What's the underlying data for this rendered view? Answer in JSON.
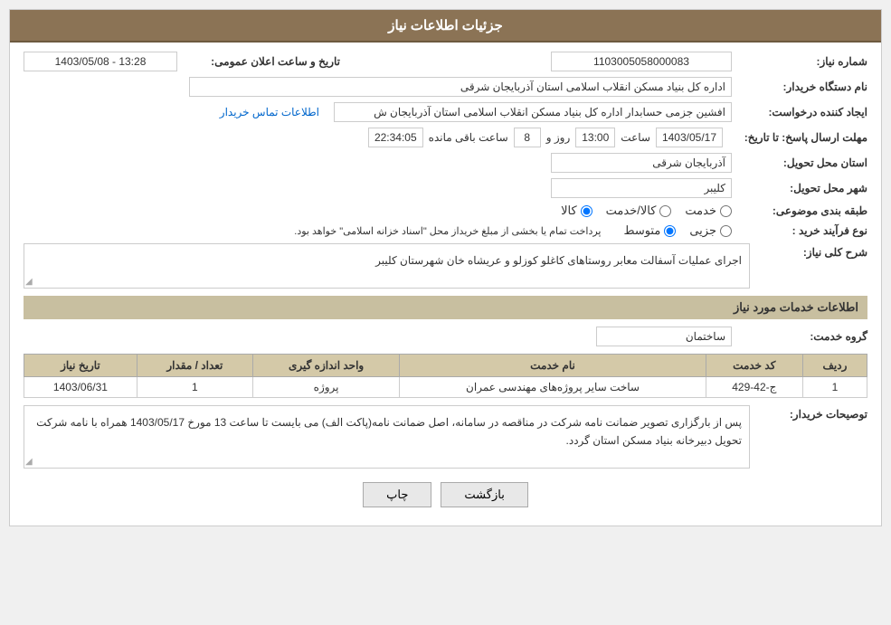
{
  "header": {
    "title": "جزئیات اطلاعات نیاز"
  },
  "fields": {
    "niaz_number_label": "شماره نیاز:",
    "niaz_number_value": "1103005058000083",
    "tarikh_label": "تاریخ و ساعت اعلان عمومی:",
    "tarikh_value": "1403/05/08 - 13:28",
    "dasgah_label": "نام دستگاه خریدار:",
    "dasgah_value": "اداره کل بنیاد مسکن انقلاب اسلامی استان آذربایجان شرقی",
    "ijad_label": "ایجاد کننده درخواست:",
    "ijad_value": "افشین جزمی حسابدار اداره کل بنیاد مسکن انقلاب اسلامی استان آذربایجان ش",
    "ijad_link": "اطلاعات تماس خریدار",
    "mohlet_label": "مهلت ارسال پاسخ: تا تاریخ:",
    "date_value": "1403/05/17",
    "saat_label": "ساعت",
    "saat_value": "13:00",
    "rooz_label": "روز و",
    "rooz_value": "8",
    "mande_label": "ساعت باقی مانده",
    "mande_value": "22:34:05",
    "ostan_label": "استان محل تحویل:",
    "ostan_value": "آذربایجان شرقی",
    "shahr_label": "شهر محل تحویل:",
    "shahr_value": "کلیبر",
    "tabaqe_label": "طبقه بندی موضوعی:",
    "tabaqe_options": [
      "خدمت",
      "کالا/خدمت",
      "کالا"
    ],
    "tabaqe_selected": "کالا",
    "farآind_label": "نوع فرآیند خرید :",
    "farayand_options": [
      "جزیی",
      "متوسط"
    ],
    "farayand_note": "پرداخت تمام یا بخشی از مبلغ خریداز محل \"اسناد خزانه اسلامی\" خواهد بود.",
    "sharh_label": "شرح کلی نیاز:",
    "sharh_value": "اجرای عملیات آسفالت معابر روستاهای کاغلو کوزلو و عریشاه خان شهرستان کلیبر",
    "khadamat_title": "اطلاعات خدمات مورد نیاز",
    "goroh_label": "گروه خدمت:",
    "goroh_value": "ساختمان",
    "table": {
      "headers": [
        "ردیف",
        "کد خدمت",
        "نام خدمت",
        "واحد اندازه گیری",
        "تعداد / مقدار",
        "تاریخ نیاز"
      ],
      "rows": [
        {
          "radif": "1",
          "code": "ج-42-429",
          "name": "ساخت سایر پروژه‌های مهندسی عمران",
          "unit": "پروژه",
          "count": "1",
          "date": "1403/06/31"
        }
      ]
    },
    "tosih_label": "توصیحات خریدار:",
    "tosih_value": "پس از بارگزاری تصویر ضمانت نامه شرکت در مناقصه در سامانه، اصل ضمانت نامه(پاکت الف) می بایست تا ساعت 13 مورخ 1403/05/17 همراه با نامه شرکت تحویل دبیرخانه بنیاد مسکن استان گردد.",
    "buttons": {
      "back_label": "بازگشت",
      "print_label": "چاپ"
    }
  }
}
